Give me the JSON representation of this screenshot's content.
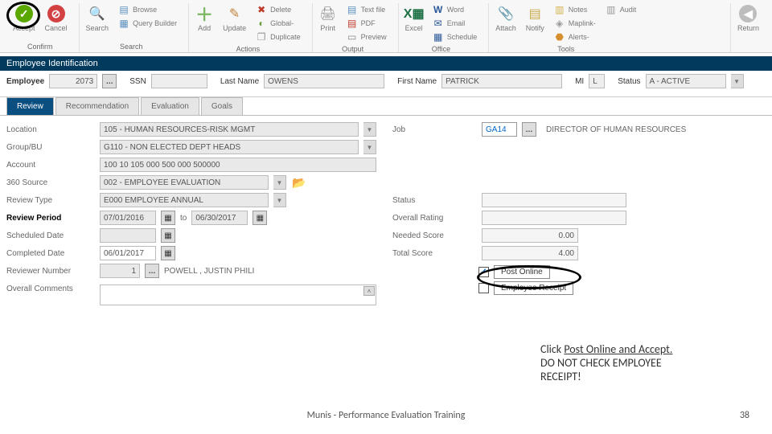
{
  "ribbon": {
    "groups": {
      "confirm": {
        "footer": "Confirm",
        "accept": "Accept",
        "cancel": "Cancel"
      },
      "search": {
        "footer": "Search",
        "search": "Search",
        "browse": "Browse",
        "query": "Query Builder"
      },
      "actions": {
        "footer": "Actions",
        "add": "Add",
        "update": "Update",
        "delete": "Delete",
        "global": "Global-",
        "duplicate": "Duplicate"
      },
      "output": {
        "footer": "Output",
        "print": "Print",
        "text": "Text file",
        "pdf": "PDF",
        "preview": "Preview"
      },
      "office": {
        "footer": "Office",
        "excel": "Excel",
        "word": "Word",
        "email": "Email",
        "schedule": "Schedule"
      },
      "tools": {
        "footer": "Tools",
        "attach": "Attach",
        "notify": "Notify",
        "notes": "Notes",
        "maplink": "Maplink-",
        "audit": "Audit",
        "alerts": "Alerts-"
      },
      "return": {
        "return": "Return"
      }
    }
  },
  "section_header": "Employee Identification",
  "emp_row": {
    "employee_lbl": "Employee",
    "employee_val": "2073",
    "ssn_lbl": "SSN",
    "ssn_val": "",
    "last_lbl": "Last Name",
    "last_val": "OWENS",
    "first_lbl": "First Name",
    "first_val": "PATRICK",
    "mi_lbl": "MI",
    "mi_val": "L",
    "status_lbl": "Status",
    "status_val": "A - ACTIVE"
  },
  "tabs": [
    "Review",
    "Recommendation",
    "Evaluation",
    "Goals"
  ],
  "form": {
    "location_lbl": "Location",
    "location_val": "105 - HUMAN RESOURCES-RISK MGMT",
    "job_lbl": "Job",
    "job_code": "GA14",
    "job_title": "DIRECTOR OF HUMAN RESOURCES",
    "group_lbl": "Group/BU",
    "group_val": "G110 - NON ELECTED DEPT HEADS",
    "account_lbl": "Account",
    "account_val": "100 10 105 000 500 000 500000",
    "source_lbl": "360 Source",
    "source_val": "002 - EMPLOYEE EVALUATION",
    "type_lbl": "Review Type",
    "type_val": "E000  EMPLOYEE ANNUAL",
    "period_lbl": "Review Period",
    "period_from": "07/01/2016",
    "period_to_lbl": "to",
    "period_to": "06/30/2017",
    "sched_lbl": "Scheduled Date",
    "sched_val": "",
    "compl_lbl": "Completed Date",
    "compl_val": "06/01/2017",
    "reviewer_lbl": "Reviewer Number",
    "reviewer_num": "1",
    "reviewer_name": "POWELL , JUSTIN PHILI",
    "comments_lbl": "Overall Comments",
    "status_lbl": "Status",
    "status_val": "",
    "rating_lbl": "Overall Rating",
    "rating_val": "",
    "needed_lbl": "Needed Score",
    "needed_val": "0.00",
    "total_lbl": "Total Score",
    "total_val": "4.00",
    "post_online": "Post Online",
    "emp_receipt": "Employee Receipt"
  },
  "instruction": {
    "line1a": "Click ",
    "line1b": "Post Online and Accept.",
    "line2": "DO NOT CHECK EMPLOYEE",
    "line3": "RECEIPT!"
  },
  "footer": {
    "title": "Munis - Performance Evaluation Training",
    "page": "38"
  }
}
